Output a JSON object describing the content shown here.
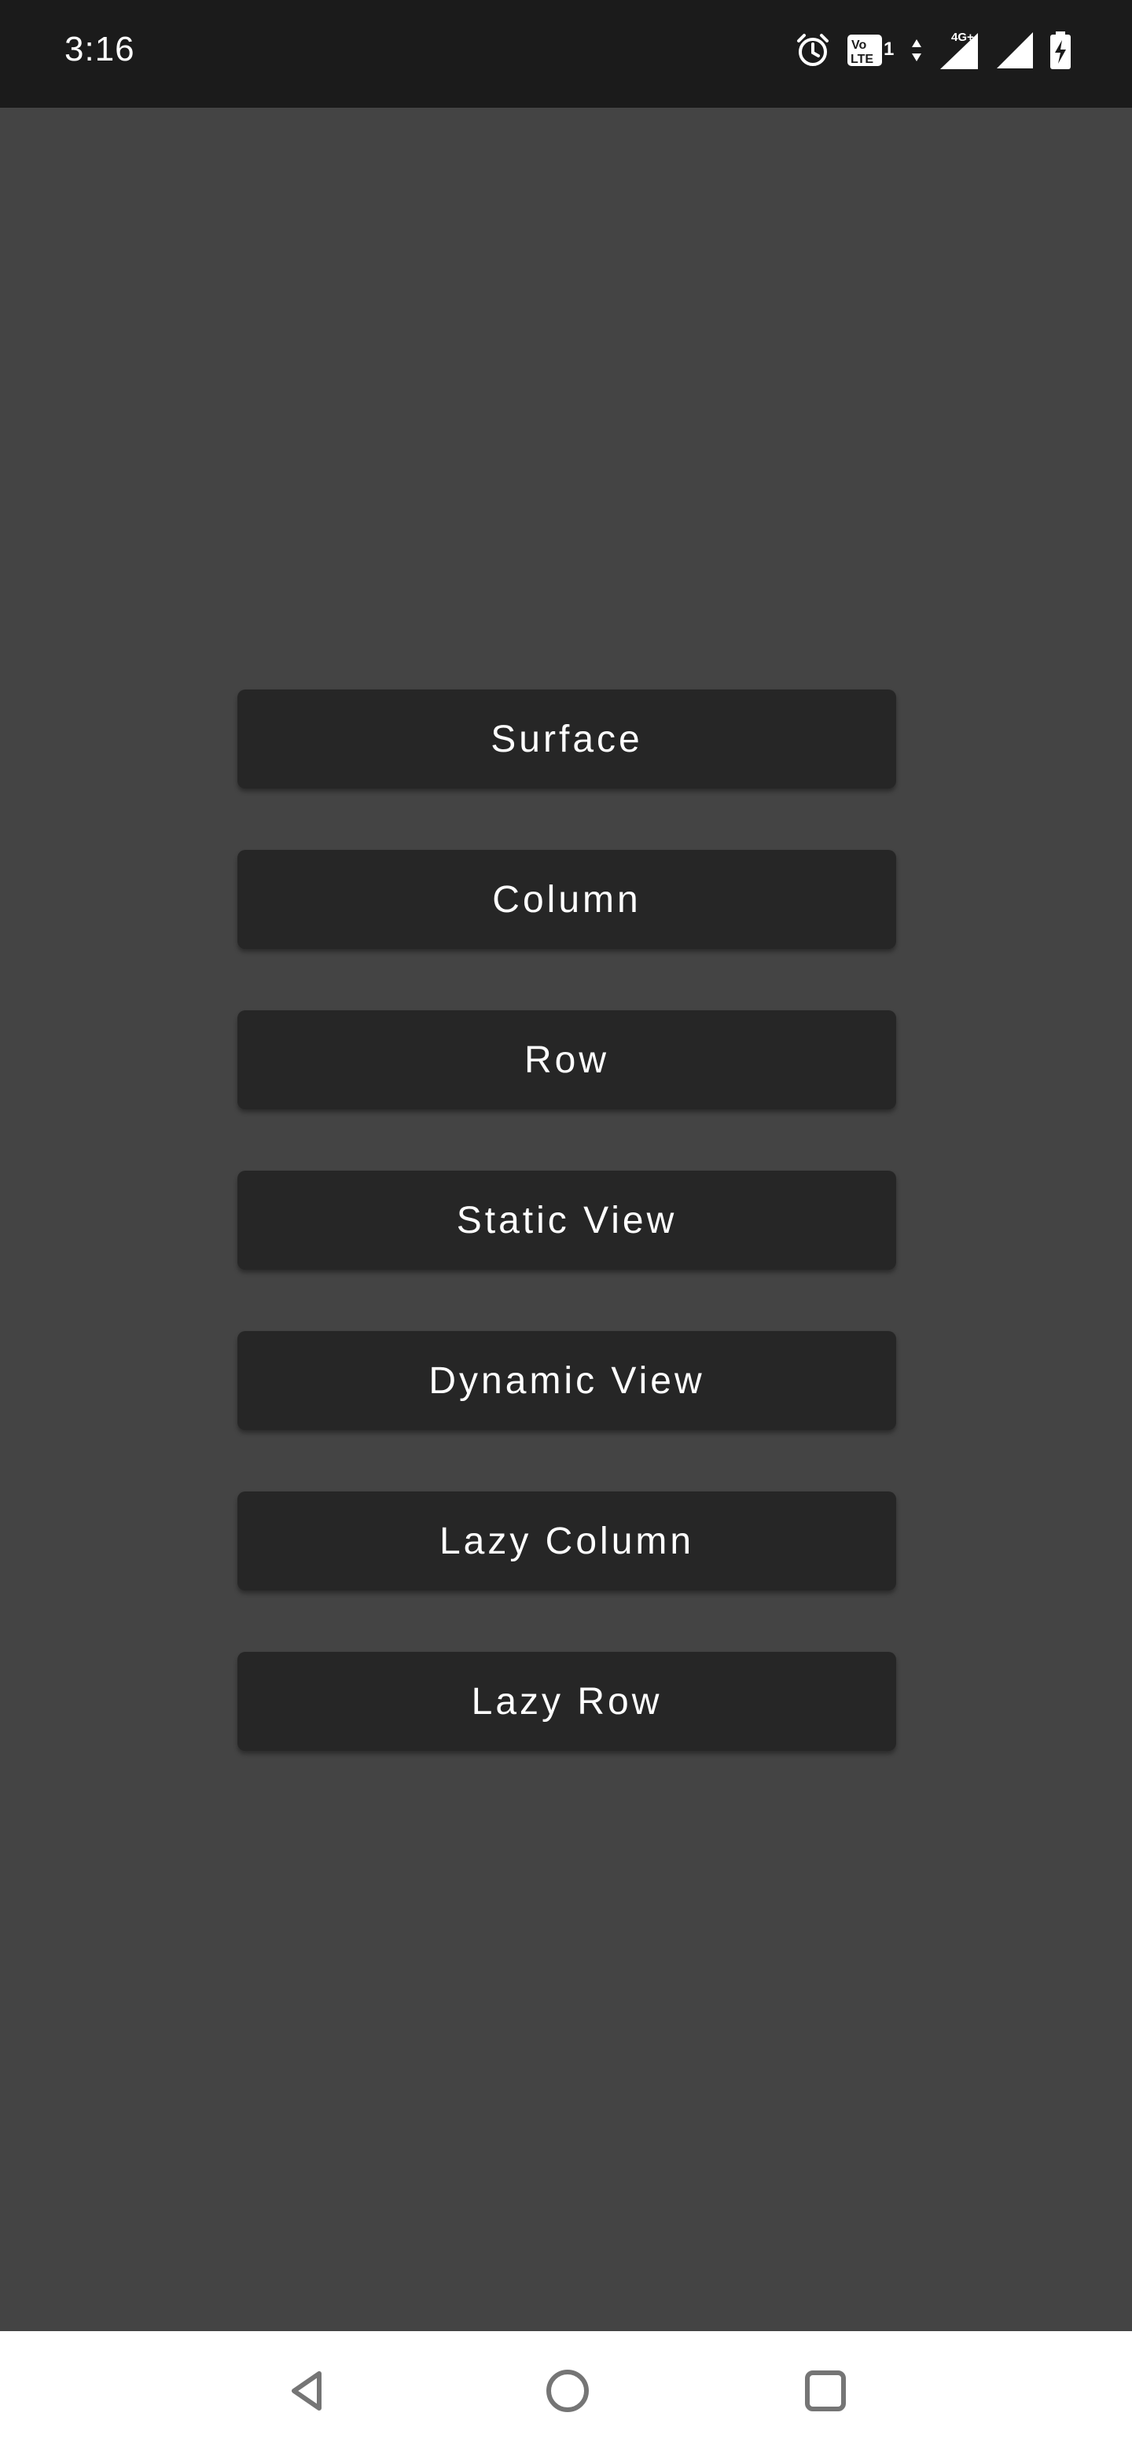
{
  "status_bar": {
    "time": "3:16",
    "icons": [
      "alarm-icon",
      "volte-icon",
      "data-arrows-icon",
      "signal-4g-icon",
      "signal-icon",
      "battery-charging-icon"
    ],
    "network_label": "4G+",
    "volte_label": "Vo LTE 1"
  },
  "main": {
    "buttons": [
      {
        "label": "Surface"
      },
      {
        "label": "Column"
      },
      {
        "label": "Row"
      },
      {
        "label": "Static View"
      },
      {
        "label": "Dynamic View"
      },
      {
        "label": "Lazy Column"
      },
      {
        "label": "Lazy Row"
      }
    ]
  },
  "nav_bar": {
    "items": [
      "back-icon",
      "home-icon",
      "recents-icon"
    ]
  },
  "colors": {
    "background": "#444444",
    "status_bar": "#1b1b1b",
    "button": "#262626",
    "button_text": "#ffffff",
    "nav_bar": "#ffffff"
  }
}
